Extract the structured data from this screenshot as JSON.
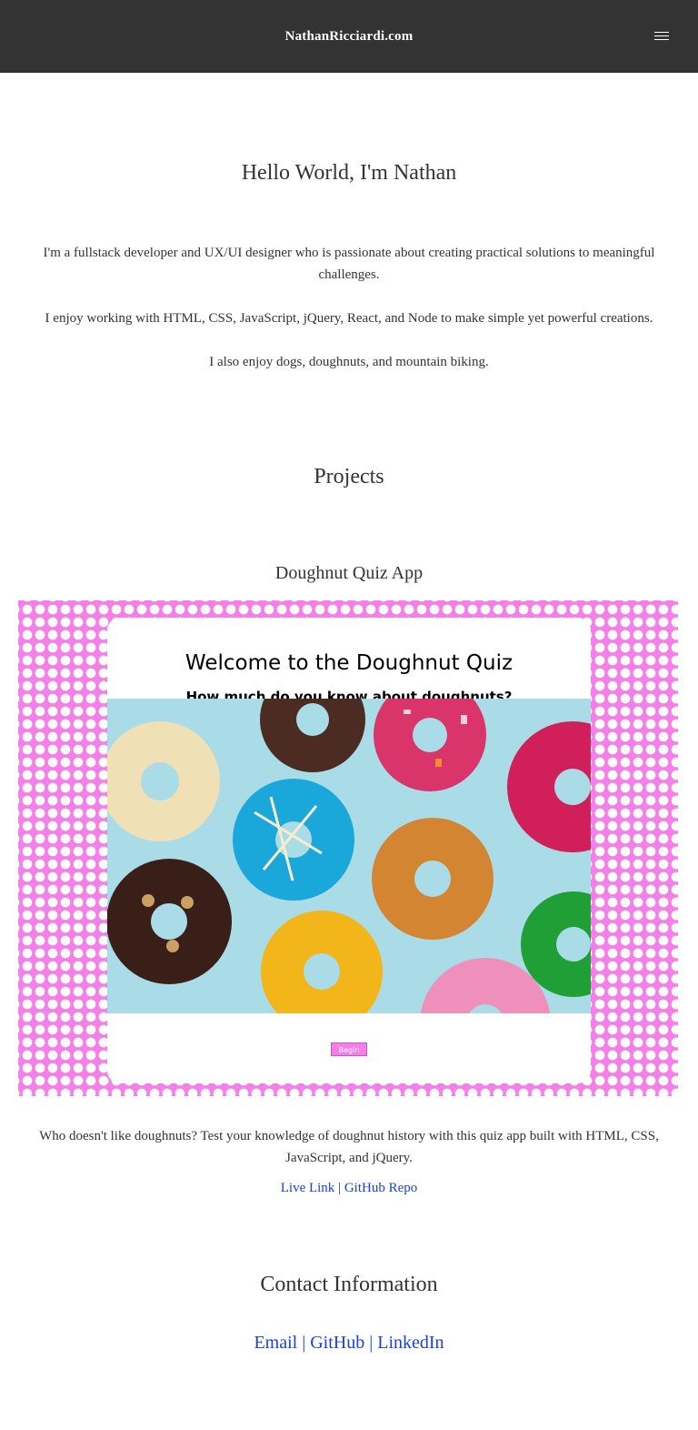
{
  "header": {
    "site_name": "NathanRicciardi.com",
    "menu_icon": "hamburger-menu-icon"
  },
  "hero": {
    "title": "Hello World, I'm Nathan",
    "bio_1": "I'm a fullstack developer and UX/UI designer who is passionate about creating practical solutions to meaningful challenges.",
    "bio_2": "I enjoy working with HTML, CSS, JavaScript, jQuery, React, and Node to make simple yet powerful creations.",
    "bio_3": "I also enjoy dogs, doughnuts, and mountain biking."
  },
  "projects": {
    "title": "Projects",
    "items": [
      {
        "title": "Doughnut Quiz App",
        "screenshot": {
          "title": "Welcome to the Doughnut Quiz",
          "subtitle": "How much do you know about doughnuts?",
          "button": "Begin"
        },
        "description": "Who doesn't like doughnuts? Test your knowledge of doughnut history with this quiz app built with HTML, CSS, JavaScript, and jQuery.",
        "live_link": "Live Link",
        "separator": "|",
        "repo_link": "GitHub Repo"
      }
    ]
  },
  "contact": {
    "title": "Contact Information",
    "email": "Email",
    "github": "GitHub",
    "linkedin": "LinkedIn",
    "separator": "|"
  },
  "colors": {
    "header_bg": "#333333",
    "accent_pink": "#f57fe8",
    "link_blue": "#1a3fe0"
  }
}
